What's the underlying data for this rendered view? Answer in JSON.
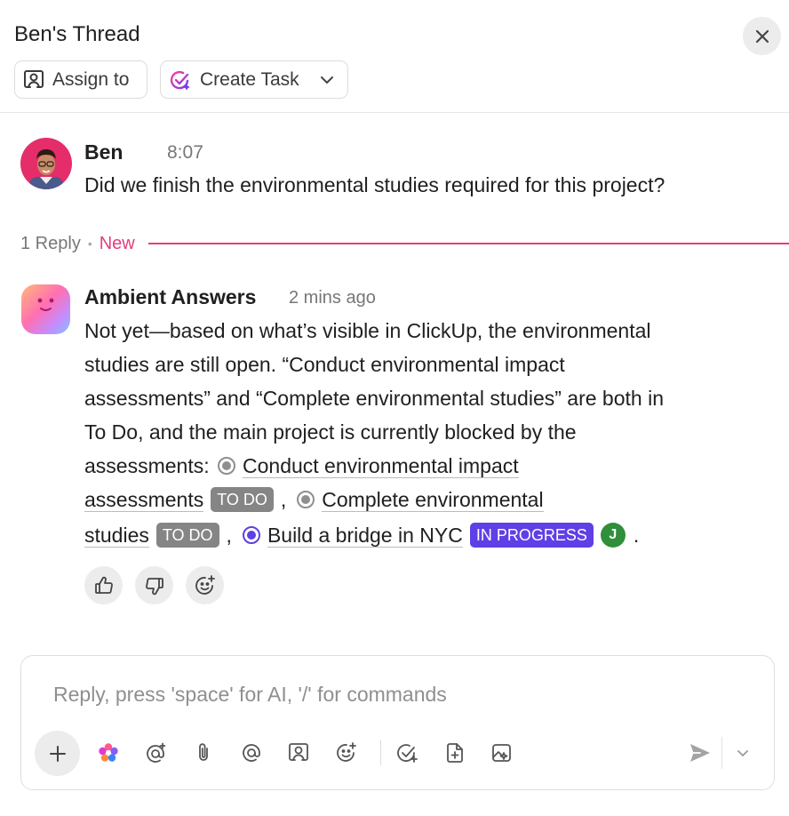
{
  "header": {
    "title": "Ben's Thread",
    "assign_label": "Assign to",
    "create_task_label": "Create Task"
  },
  "message": {
    "author": "Ben",
    "time": "8:07",
    "text": "Did we finish the environmental studies required for this project?"
  },
  "replies": {
    "count_label": "1 Reply",
    "new_label": "New"
  },
  "ai_reply": {
    "author": "Ambient Answers",
    "time": "2 mins ago",
    "line1": "Not yet—based on what’s visible in ClickUp, the environmental",
    "line2": "studies are still open. “Conduct environmental impact",
    "line3": "assessments” and “Complete environmental studies” are both in",
    "line4": "To Do, and the main project is currently blocked by the",
    "line5_prefix": "assessments: ",
    "task1_part1": "Conduct environmental impact",
    "task1_part2": "assessments",
    "task1_status": "TO DO",
    "comma": ",",
    "task2_part1": "Complete environmental",
    "task2_part2": "studies",
    "task2_status": "TO DO",
    "task3_name": "Build a bridge in NYC",
    "task3_status": "IN PROGRESS",
    "task3_assignee": "J",
    "period": "."
  },
  "composer": {
    "placeholder": "Reply, press 'space' for AI, '/' for commands"
  },
  "colors": {
    "accent_pink": "#e33d7c",
    "in_progress": "#5f3fe6",
    "todo": "#858585",
    "assignee_green": "#2f8f3a"
  },
  "icons": {
    "close": "close-icon",
    "assign": "assign-person-icon",
    "create_task": "sparkle-check-icon",
    "thumbs_up": "thumbs-up-icon",
    "thumbs_down": "thumbs-down-icon",
    "emoji": "emoji-add-icon",
    "send": "send-icon"
  }
}
